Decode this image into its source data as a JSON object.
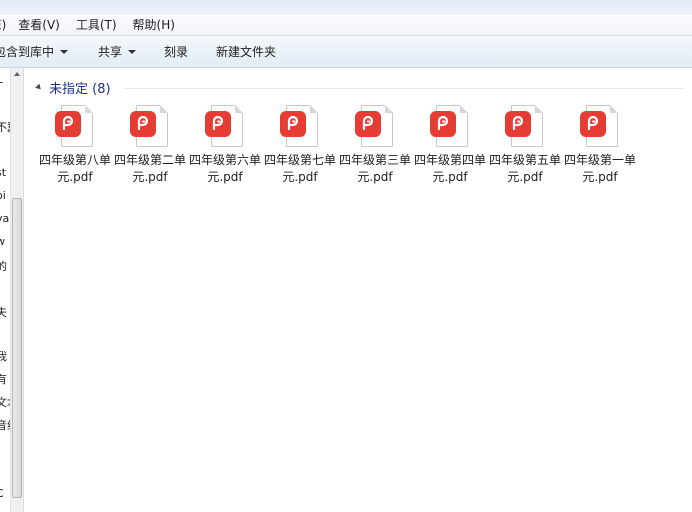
{
  "menubar": {
    "items": [
      "E)",
      "查看(V)",
      "工具(T)",
      "帮助(H)"
    ]
  },
  "toolbar": {
    "include_library": "包含到库中",
    "share": "共享",
    "burn": "刻录",
    "new_folder": "新建文件夹"
  },
  "nav": {
    "fragments": [
      "T",
      "不翼",
      "st",
      "oi",
      "va",
      "w",
      "的",
      "\\",
      "夫",
      "我",
      "有",
      "文木",
      "音纸",
      "C"
    ]
  },
  "group": {
    "title": "未指定 (8)"
  },
  "files": [
    {
      "name": "四年级第八单元.pdf"
    },
    {
      "name": "四年级第二单元.pdf"
    },
    {
      "name": "四年级第六单元.pdf"
    },
    {
      "name": "四年级第七单元.pdf"
    },
    {
      "name": "四年级第三单元.pdf"
    },
    {
      "name": "四年级第四单元.pdf"
    },
    {
      "name": "四年级第五单元.pdf"
    },
    {
      "name": "四年级第一单元.pdf"
    }
  ],
  "colors": {
    "pdf_badge": "#e53c33",
    "group_title": "#1e3287"
  },
  "icons": {
    "file": "pdf-file-icon"
  }
}
